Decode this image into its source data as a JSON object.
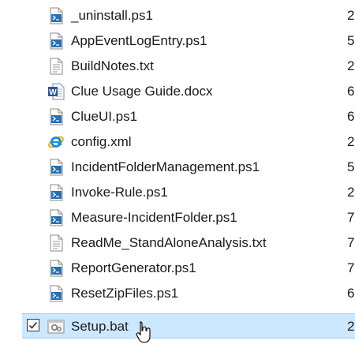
{
  "files": [
    {
      "name": "_uninstall.ps1",
      "icon": "powershell-script-icon",
      "trail": "2"
    },
    {
      "name": "AppEventLogEntry.ps1",
      "icon": "powershell-script-icon",
      "trail": "5"
    },
    {
      "name": "BuildNotes.txt",
      "icon": "text-file-icon",
      "trail": "2"
    },
    {
      "name": "Clue Usage Guide.docx",
      "icon": "word-document-icon",
      "trail": "6"
    },
    {
      "name": "ClueUI.ps1",
      "icon": "powershell-script-icon",
      "trail": "6"
    },
    {
      "name": "config.xml",
      "icon": "internet-explorer-icon",
      "trail": "2"
    },
    {
      "name": "IncidentFolderManagement.ps1",
      "icon": "powershell-script-icon",
      "trail": "5"
    },
    {
      "name": "Invoke-Rule.ps1",
      "icon": "powershell-script-icon",
      "trail": "2"
    },
    {
      "name": "Measure-IncidentFolder.ps1",
      "icon": "powershell-script-icon",
      "trail": "7"
    },
    {
      "name": "ReadMe_StandAloneAnalysis.txt",
      "icon": "text-file-icon",
      "trail": "7"
    },
    {
      "name": "ReportGenerator.ps1",
      "icon": "powershell-script-icon",
      "trail": "7"
    },
    {
      "name": "ResetZipFiles.ps1",
      "icon": "powershell-script-icon",
      "trail": "6"
    },
    {
      "name": "Setup.bat",
      "icon": "batch-file-icon",
      "trail": "2",
      "selected": true
    }
  ],
  "colors": {
    "selection": "#cce8ff",
    "selection_border": "#99d1ff",
    "powershell_blue": "#2a6fb5",
    "word_blue": "#2b579a",
    "ie_blue": "#1e8fe0",
    "ie_gold": "#f0b400"
  }
}
